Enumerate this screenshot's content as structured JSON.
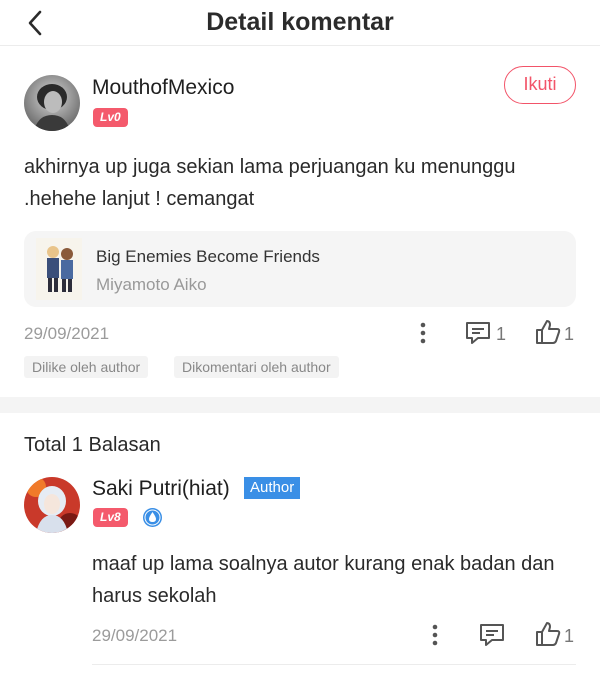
{
  "header": {
    "title": "Detail komentar"
  },
  "comment": {
    "username": "MouthofMexico",
    "level": "Lv0",
    "follow_label": "Ikuti",
    "text": "akhirnya up juga sekian lama perjuangan ku menunggu .hehehe lanjut ! cemangat",
    "book": {
      "title": "Big Enemies Become Friends",
      "author": "Miyamoto Aiko"
    },
    "date": "29/09/2021",
    "reply_count": "1",
    "like_count": "1",
    "tags": [
      "Dilike oleh author",
      "Dikomentari oleh author"
    ]
  },
  "replies_header": "Total 1 Balasan",
  "reply": {
    "username": "Saki Putri(hiat)",
    "author_tag": "Author",
    "level": "Lv8",
    "text": "maaf up lama soalnya autor kurang enak badan dan harus sekolah",
    "date": "29/09/2021",
    "like_count": "1"
  },
  "colors": {
    "accent": "#f25469",
    "author_blue": "#3a8fe6",
    "level_badge": "#f45a6c"
  }
}
